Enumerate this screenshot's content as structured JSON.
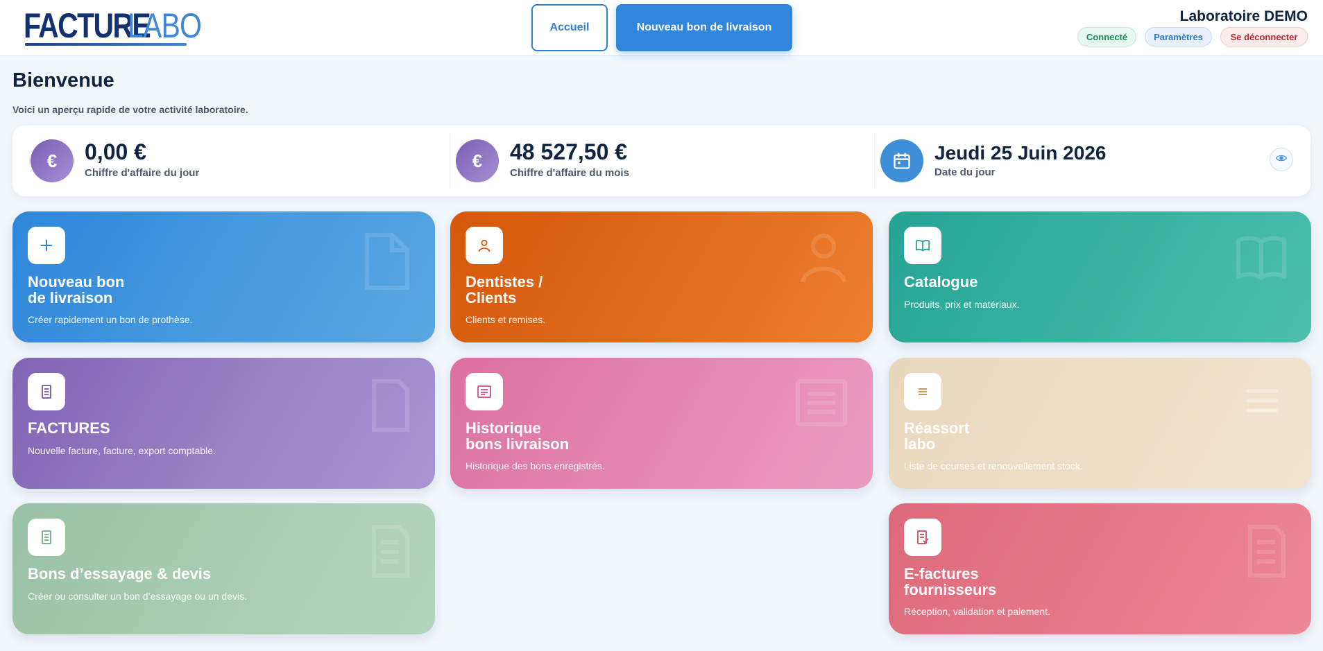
{
  "header": {
    "logo_word1": "FACTURE",
    "logo_word2": "LABO",
    "nav_home": "Accueil",
    "nav_new_delivery": "Nouveau bon de livraison",
    "lab_name": "Laboratoire DEMO",
    "status_badge": "Connecté",
    "settings_link": "Paramètres",
    "logout_link": "Se déconnecter"
  },
  "welcome": {
    "title": "Bienvenue",
    "subtitle": "Voici un aperçu rapide de votre activité laboratoire."
  },
  "stats": [
    {
      "icon": "euro-icon",
      "value": "0,00 €",
      "label": "Chiffre d'affaire du jour"
    },
    {
      "icon": "euro-icon",
      "value": "48 527,50 €",
      "label": "Chiffre d'affaire du mois"
    },
    {
      "icon": "calendar-icon",
      "value": "Jeudi 25 Juin 2026",
      "label": "Date du jour"
    }
  ],
  "stats_euro_symbol": "€",
  "cards": [
    {
      "title1": "Nouveau bon",
      "title2": "de livraison",
      "desc": "Créer rapidement un bon de prothèse.",
      "icon": "plus-icon",
      "color": "#2e86db"
    },
    {
      "title1": "Dentistes /",
      "title2": "Clients",
      "desc": "Clients et remises.",
      "icon": "user-icon",
      "color": "#d5580a"
    },
    {
      "title1": "Catalogue",
      "title2": "",
      "desc": "Produits, prix et matériaux.",
      "icon": "book-icon",
      "color": "#25a495"
    },
    {
      "title1": "FACTURES",
      "title2": "",
      "desc": "Nouvelle facture, facture, export comptable.",
      "icon": "invoice-icon",
      "color": "#8064b5"
    },
    {
      "title1": "Historique",
      "title2": "bons livraison",
      "desc": "Historique des bons enregistrés.",
      "icon": "history-icon",
      "color": "#dc719f"
    },
    {
      "title1": "Réassort",
      "title2": "labo",
      "desc": "Liste de courses et renouvellement stock.",
      "icon": "list-icon",
      "color": "#ead8bd"
    },
    {
      "title1": "Bons d’essayage & devis",
      "title2": "",
      "desc": "Créer ou consulter un bon d’essayage ou un devis.",
      "icon": "document-icon",
      "color": "#99c1a5"
    },
    {
      "title1": "E-factures",
      "title2": "fournisseurs",
      "desc": "Réception, validation et paiement.",
      "icon": "e-invoice-icon",
      "color": "#dd6a7a"
    }
  ]
}
